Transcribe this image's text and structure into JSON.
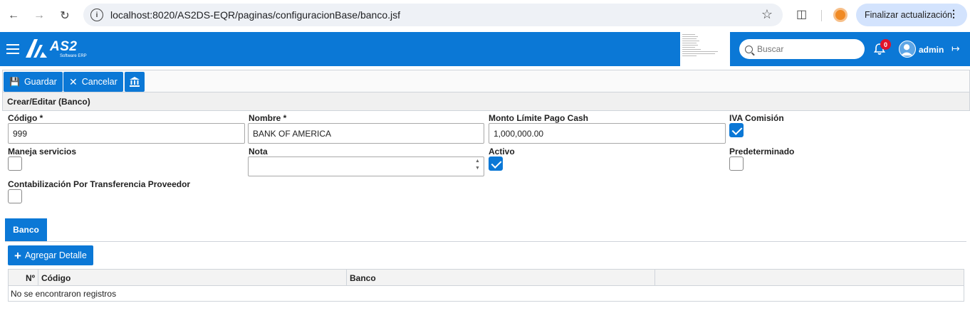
{
  "browser": {
    "url": "localhost:8020/AS2DS-EQR/paginas/configuracionBase/banco.jsf",
    "update_label": "Finalizar actualización"
  },
  "header": {
    "brand": "AS2",
    "brand_sub": "Software ERP",
    "search_placeholder": "Buscar",
    "notifications_count": "0",
    "username": "admin",
    "color": "#0b78d6"
  },
  "toolbar": {
    "save_label": "Guardar",
    "cancel_label": "Cancelar"
  },
  "form": {
    "title": "Crear/Editar (Banco)",
    "codigo_label": "Código *",
    "codigo_value": "999",
    "nombre_label": "Nombre *",
    "nombre_value": "BANK OF AMERICA",
    "monto_label": "Monto Límite Pago Cash",
    "monto_value": "1,000,000.00",
    "iva_label": "IVA Comisión",
    "iva_checked": true,
    "maneja_label": "Maneja servicios",
    "maneja_checked": false,
    "nota_label": "Nota",
    "nota_value": "",
    "activo_label": "Activo",
    "activo_checked": true,
    "predeterminado_label": "Predeterminado",
    "predeterminado_checked": false,
    "contab_label": "Contabilización Por Transferencia Proveedor",
    "contab_checked": false
  },
  "detail": {
    "tab_label": "Banco",
    "add_label": "Agregar Detalle",
    "columns": [
      "Nº",
      "Código",
      "Banco",
      ""
    ],
    "empty_message": "No se encontraron registros"
  }
}
